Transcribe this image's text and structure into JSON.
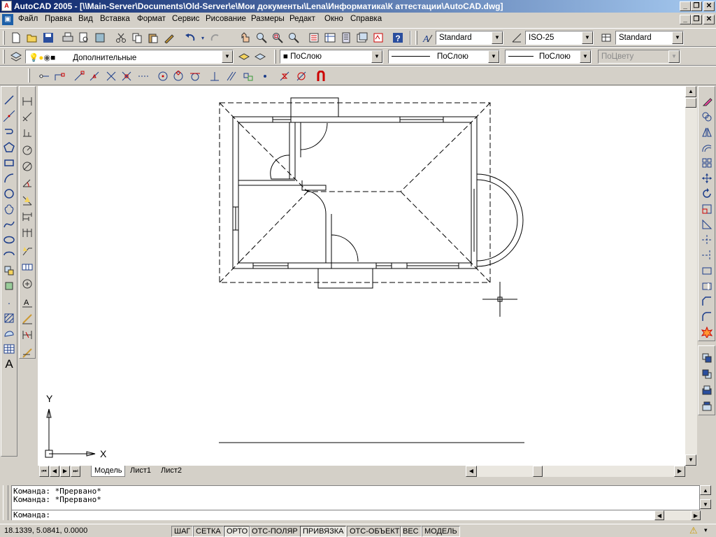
{
  "window": {
    "title": "AutoCAD 2005 - [\\\\Main-Server\\Documents\\Old-Server\\e\\Мои документы\\Lena\\Информатика\\К аттестации\\AutoCAD.dwg]",
    "app_icon": "A",
    "minimize": "_",
    "restore": "❐",
    "close": "✕"
  },
  "menu": {
    "app_icon": "▣",
    "items": [
      "Файл",
      "Правка",
      "Вид",
      "Вставка",
      "Формат",
      "Сервис",
      "Рисование",
      "Размеры",
      "Редакт",
      "Окно",
      "Справка"
    ]
  },
  "toolbar": {
    "text_style": "Standard",
    "dim_style": "ISO-25",
    "table_style": "Standard",
    "layer": "Дополнительные",
    "color": "ПоСлою",
    "linetype": "ПоСлою",
    "lineweight": "ПоСлою",
    "plotstyle": "ПоЦвету"
  },
  "icons": {
    "standard": [
      "new-icon",
      "open-icon",
      "save-icon",
      "print-icon",
      "preview-icon",
      "publish-icon",
      "cut-icon",
      "copy-icon",
      "paste-icon",
      "matchprop-icon",
      "undo-icon",
      "redo-icon",
      "pan-icon",
      "zoom-realtime-icon",
      "zoom-window-icon",
      "zoom-previous-icon",
      "properties-icon",
      "designcenter-icon",
      "toolpalettes-icon",
      "markup-icon",
      "help-icon"
    ],
    "draw": [
      "line-icon",
      "construction-line-icon",
      "polyline-icon",
      "polygon-icon",
      "rectangle-icon",
      "arc-icon",
      "circle-icon",
      "revision-cloud-icon",
      "spline-icon",
      "ellipse-icon",
      "ellipse-arc-icon",
      "insert-block-icon",
      "make-block-icon",
      "point-icon",
      "hatch-icon",
      "region-icon",
      "table-icon",
      "mtext-icon"
    ],
    "modify": [
      "erase-icon",
      "copy-object-icon",
      "mirror-icon",
      "offset-icon",
      "array-icon",
      "move-icon",
      "rotate-icon",
      "scale-icon",
      "stretch-icon",
      "trim-icon",
      "extend-icon",
      "break-at-point-icon",
      "break-icon",
      "chamfer-icon",
      "fillet-icon",
      "explode-icon"
    ]
  },
  "ucs": {
    "x_label": "X",
    "y_label": "Y"
  },
  "layout_tabs": [
    "Модель",
    "Лист1",
    "Лист2"
  ],
  "command": {
    "history": [
      "Команда: *Прервано*",
      "Команда: *Прервано*"
    ],
    "prompt": "Команда:"
  },
  "status": {
    "coords": "18.1339, 5.0841, 0.0000",
    "buttons": [
      {
        "label": "ШАГ",
        "on": false
      },
      {
        "label": "СЕТКА",
        "on": false
      },
      {
        "label": "ОРТО",
        "on": true
      },
      {
        "label": "ОТС-ПОЛЯР",
        "on": false
      },
      {
        "label": "ПРИВЯЗКА",
        "on": true
      },
      {
        "label": "ОТС-ОБЪЕКТ",
        "on": false
      },
      {
        "label": "ВЕС",
        "on": false
      },
      {
        "label": "МОДЕЛЬ",
        "on": false
      }
    ]
  }
}
